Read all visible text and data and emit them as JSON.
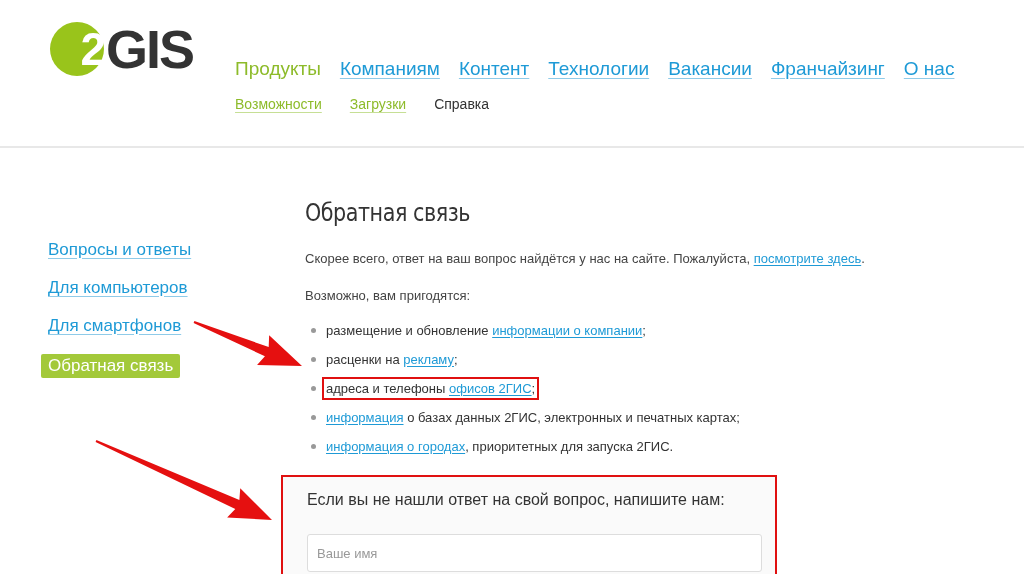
{
  "logo": {
    "mark": "2",
    "name": "GIS"
  },
  "nav": [
    {
      "label": "Продукты",
      "selected": true
    },
    {
      "label": "Компаниям",
      "selected": false
    },
    {
      "label": "Контент",
      "selected": false
    },
    {
      "label": "Технологии",
      "selected": false
    },
    {
      "label": "Вакансии",
      "selected": false
    },
    {
      "label": "Франчайзинг",
      "selected": false
    },
    {
      "label": "О нас",
      "selected": false
    }
  ],
  "subnav": [
    {
      "label": "Возможности",
      "selected": false
    },
    {
      "label": "Загрузки",
      "selected": false
    },
    {
      "label": "Справка",
      "selected": true
    }
  ],
  "sidebar": {
    "items": [
      {
        "label": "Вопросы и ответы",
        "selected": false
      },
      {
        "label": "Для компьютеров",
        "selected": false
      },
      {
        "label": "Для смартфонов",
        "selected": false
      },
      {
        "label": "Обратная связь",
        "selected": true
      }
    ]
  },
  "content": {
    "title": "Обратная связь",
    "intro": [
      {
        "text": "Скорее всего, ответ на ваш вопрос найдётся у нас на сайте. Пожалуйста, ",
        "link": false
      },
      {
        "text": "посмотрите здесь",
        "link": true
      },
      {
        "text": ".",
        "link": false
      }
    ],
    "list_heading": "Возможно, вам пригодятся:",
    "list": [
      {
        "highlighted": false,
        "parts": [
          {
            "text": "размещение и обновление ",
            "link": false
          },
          {
            "text": "информации о компании",
            "link": true
          },
          {
            "text": ";",
            "link": false
          }
        ]
      },
      {
        "highlighted": false,
        "parts": [
          {
            "text": "расценки на ",
            "link": false
          },
          {
            "text": "рекламу",
            "link": true
          },
          {
            "text": ";",
            "link": false
          }
        ]
      },
      {
        "highlighted": true,
        "parts": [
          {
            "text": "адреса и телефоны ",
            "link": false
          },
          {
            "text": "офисов 2ГИС",
            "link": true
          },
          {
            "text": ";",
            "link": false
          }
        ]
      },
      {
        "highlighted": false,
        "parts": [
          {
            "text": "информация",
            "link": true
          },
          {
            "text": " о базах данных 2ГИС, электронных и печатных картах;",
            "link": false
          }
        ]
      },
      {
        "highlighted": false,
        "parts": [
          {
            "text": "информация о городах",
            "link": true
          },
          {
            "text": ", приоритетных для запуска 2ГИС.",
            "link": false
          }
        ]
      }
    ]
  },
  "form": {
    "highlighted": true,
    "title": "Если вы не нашли ответ на свой вопрос, напишите нам:",
    "name_field": {
      "placeholder": "Ваше имя"
    }
  }
}
